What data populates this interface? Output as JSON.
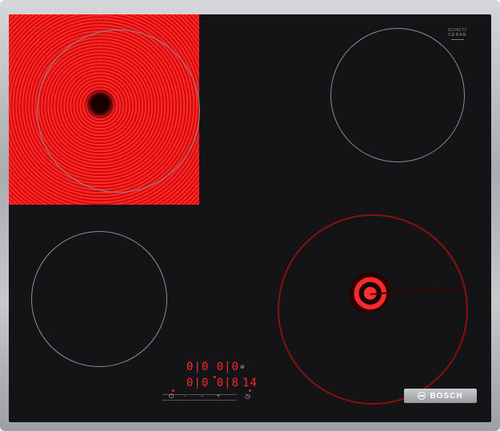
{
  "brand": {
    "name": "BOSCH"
  },
  "glass_logo": {
    "top": "SCHOTT",
    "bottom": "CERAN"
  },
  "display": {
    "top_row": "0|0 0|0",
    "bottom_row": "0|0 0|8",
    "timer": "14"
  },
  "controls": {
    "power_icon": "power-icon",
    "minus_label": "-",
    "dash_label": "–",
    "plus_label": "+",
    "timer_icon": "timer-icon",
    "lock_icon": "lock-icon"
  },
  "colors": {
    "glass": "#141416",
    "frame": "#b3b5b8",
    "hot_zone": "#e01010",
    "display_led": "#ff2a2a"
  }
}
